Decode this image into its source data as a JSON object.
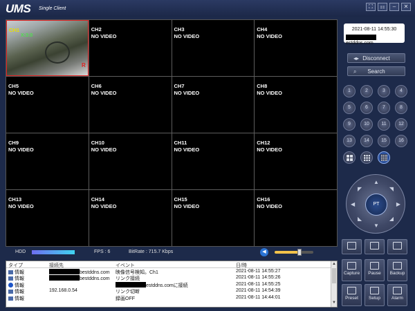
{
  "app": {
    "title": "UMS",
    "subtitle": "Single Client",
    "window_buttons": [
      "⛶",
      "⚏",
      "–",
      "✕"
    ]
  },
  "channels": [
    {
      "label": "CH1",
      "status": "",
      "overlay": "X:3:0",
      "rec": "R"
    },
    {
      "label": "CH2",
      "status": "NO VIDEO"
    },
    {
      "label": "CH3",
      "status": "NO VIDEO"
    },
    {
      "label": "CH4",
      "status": "NO VIDEO"
    },
    {
      "label": "CH5",
      "status": "NO VIDEO"
    },
    {
      "label": "CH6",
      "status": "NO VIDEO"
    },
    {
      "label": "CH7",
      "status": "NO VIDEO"
    },
    {
      "label": "CH8",
      "status": "NO VIDEO"
    },
    {
      "label": "CH9",
      "status": "NO VIDEO"
    },
    {
      "label": "CH10",
      "status": "NO VIDEO"
    },
    {
      "label": "CH11",
      "status": "NO VIDEO"
    },
    {
      "label": "CH12",
      "status": "NO VIDEO"
    },
    {
      "label": "CH13",
      "status": "NO VIDEO"
    },
    {
      "label": "CH14",
      "status": "NO VIDEO"
    },
    {
      "label": "CH15",
      "status": "NO VIDEO"
    },
    {
      "label": "CH16",
      "status": "NO VIDEO"
    }
  ],
  "status_bar": {
    "hdd_label": "HDD",
    "fps": "FPS :  6",
    "bitrate": "BitRate : 715.7 Kbps"
  },
  "log": {
    "headers": [
      "タイプ",
      "接続先",
      "イベント",
      "日/時"
    ],
    "rows": [
      {
        "type": "情報",
        "host": "bestddns.com",
        "event": "映像信号検知。Ch1",
        "time": "2021-08-11 14:55:27"
      },
      {
        "type": "情報",
        "host": "bestddns.com",
        "event": "リンク接続",
        "time": "2021-08-11 14:55:26"
      },
      {
        "type": "情報",
        "host": "",
        "event": "estddns.comに接続",
        "time": "2021-08-11 14:55:25"
      },
      {
        "type": "情報",
        "host": "192.168.0.54",
        "event": "リンク切断",
        "time": "2021-08-11 14:54:39"
      },
      {
        "type": "情報",
        "host": "",
        "event": "録画OFF",
        "time": "2021-08-11 14:44:01"
      }
    ]
  },
  "panel": {
    "datetime": "2021-08-11 14:55:30",
    "host": "estddns.com",
    "disconnect_label": "Disconnect",
    "search_label": "Search",
    "numbers": [
      "1",
      "2",
      "3",
      "4",
      "5",
      "6",
      "7",
      "8",
      "9",
      "10",
      "11",
      "12",
      "13",
      "14",
      "15",
      "16"
    ],
    "ptz_center": "PT",
    "tools_row1": [
      "",
      "",
      ""
    ],
    "tools_row2": [
      "Capture",
      "Pause",
      "Backup"
    ],
    "tools_row3": [
      "Preset",
      "Setup",
      "Alarm"
    ]
  }
}
